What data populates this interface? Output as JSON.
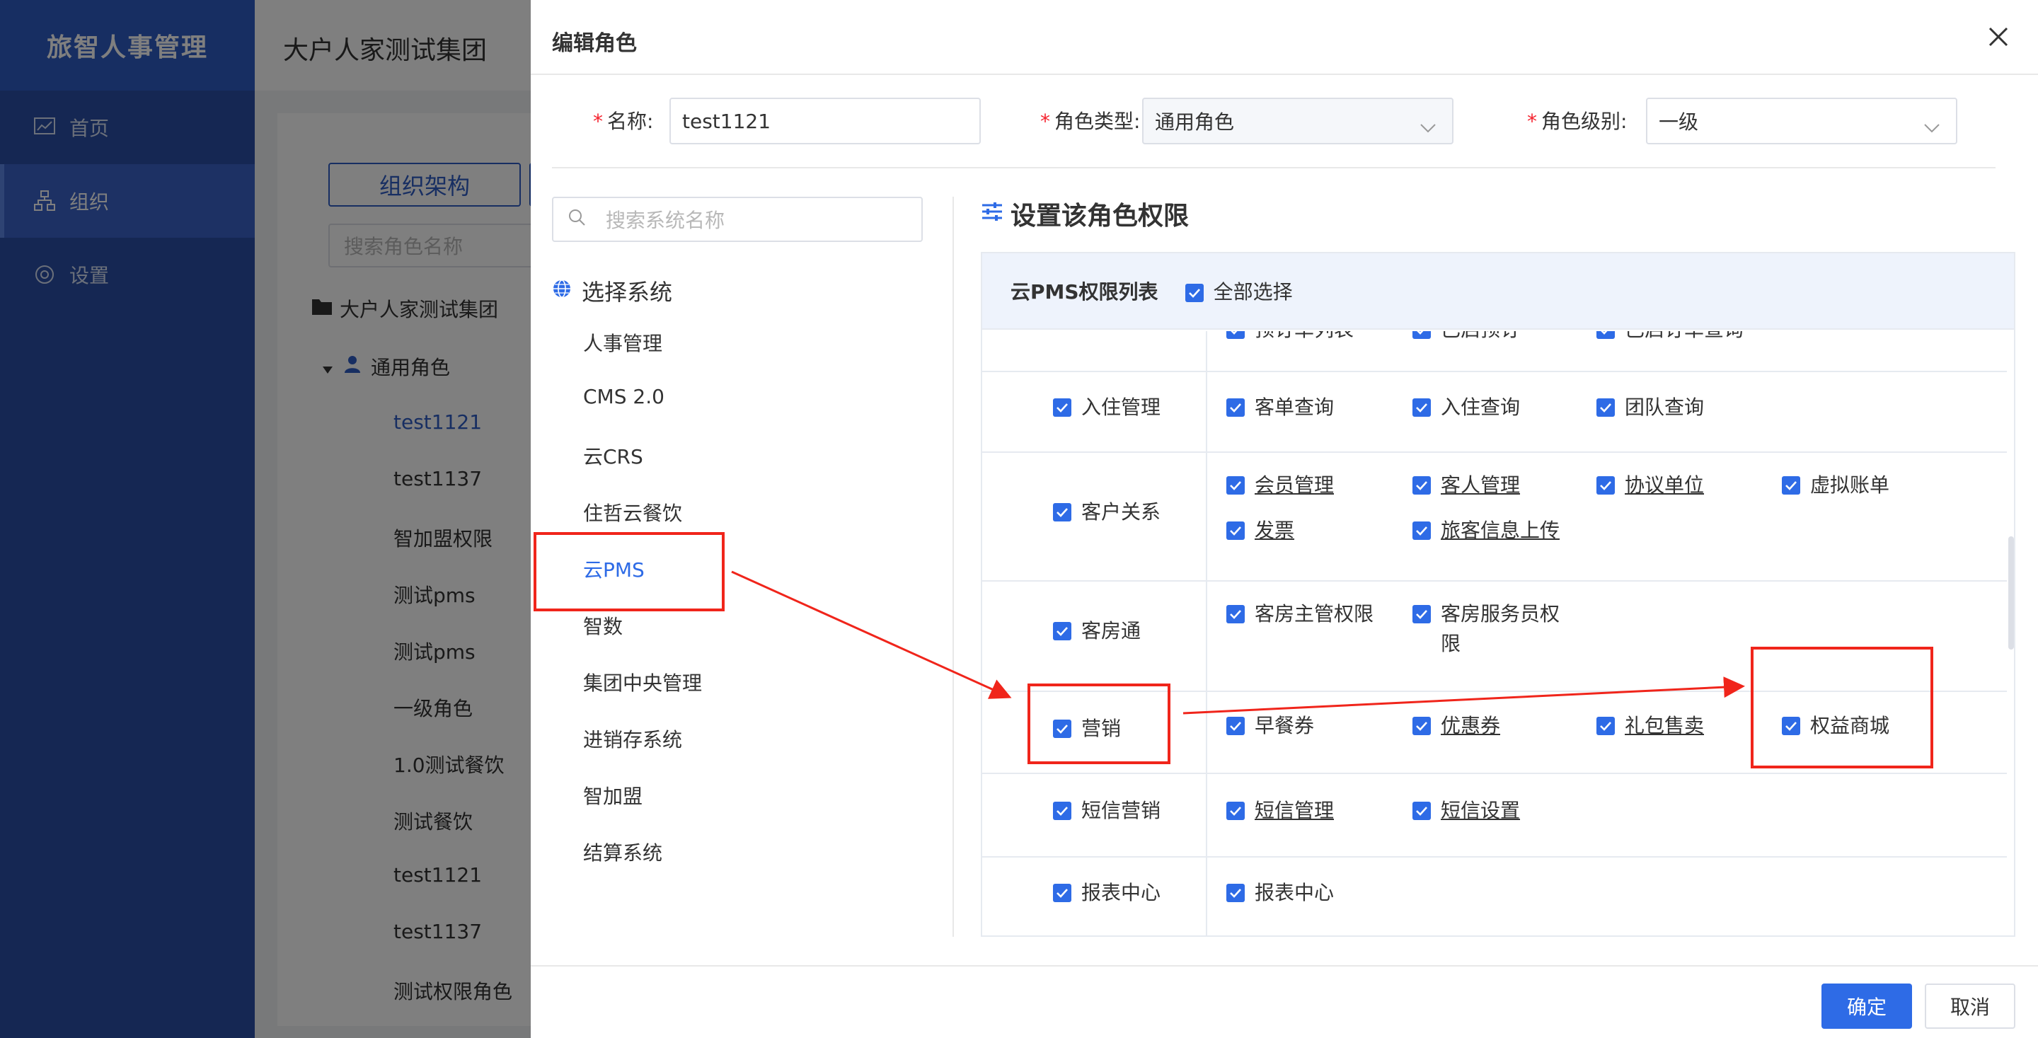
{
  "app": {
    "brand": "旅智人事管理",
    "nav": [
      {
        "label": "首页",
        "icon": "chart-icon"
      },
      {
        "label": "组织",
        "icon": "org-icon"
      },
      {
        "label": "设置",
        "icon": "gear-icon"
      }
    ],
    "header_title": "大户人家测试集团",
    "org_button": "组织架构",
    "search_placeholder": "搜索角色名称",
    "tree_root": "大户人家测试集团",
    "tree_group": "通用角色",
    "tree_items": [
      "test1121",
      "test1137",
      "智加盟权限",
      "测试pms",
      "测试pms",
      "一级角色",
      "1.0测试餐饮",
      "测试餐饮",
      "test1121",
      "test1137",
      "测试权限角色"
    ]
  },
  "dialog": {
    "title": "编辑角色",
    "form": {
      "name_label": "名称:",
      "name_value": "test1121",
      "type_label": "角色类型:",
      "type_value": "通用角色",
      "level_label": "角色级别:",
      "level_value": "一级"
    },
    "system_search_placeholder": "搜索系统名称",
    "system_title": "选择系统",
    "systems": [
      "人事管理",
      "CMS 2.0",
      "云CRS",
      "住哲云餐饮",
      "云PMS",
      "智数",
      "集团中央管理",
      "进销存系统",
      "智加盟",
      "结算系统"
    ],
    "active_system": "云PMS",
    "perm_title": "设置该角色权限",
    "perm_list_title": "云PMS权限列表",
    "select_all": "全部选择",
    "partial_row": [
      "预订单列表",
      "已启预订",
      "已启订单查询"
    ],
    "groups": [
      {
        "name": "入住管理",
        "items": [
          "客单查询",
          "入住查询",
          "团队查询"
        ]
      },
      {
        "name": "客户关系",
        "items": [
          "会员管理",
          "客人管理",
          "协议单位",
          "虚拟账单",
          "发票",
          "旅客信息上传"
        ]
      },
      {
        "name": "客房通",
        "items": [
          "客房主管权限",
          "客房服务员权",
          "限"
        ]
      },
      {
        "name": "营销",
        "items": [
          "早餐券",
          "优惠券",
          "礼包售卖",
          "权益商城"
        ]
      },
      {
        "name": "短信营销",
        "items": [
          "短信管理",
          "短信设置"
        ]
      },
      {
        "name": "报表中心",
        "items": [
          "报表中心"
        ]
      }
    ],
    "ok_button": "确定",
    "cancel_button": "取消"
  },
  "colors": {
    "sidebar": "#2b4ea6",
    "primary": "#2e6be6",
    "annotation": "#f0251b"
  }
}
